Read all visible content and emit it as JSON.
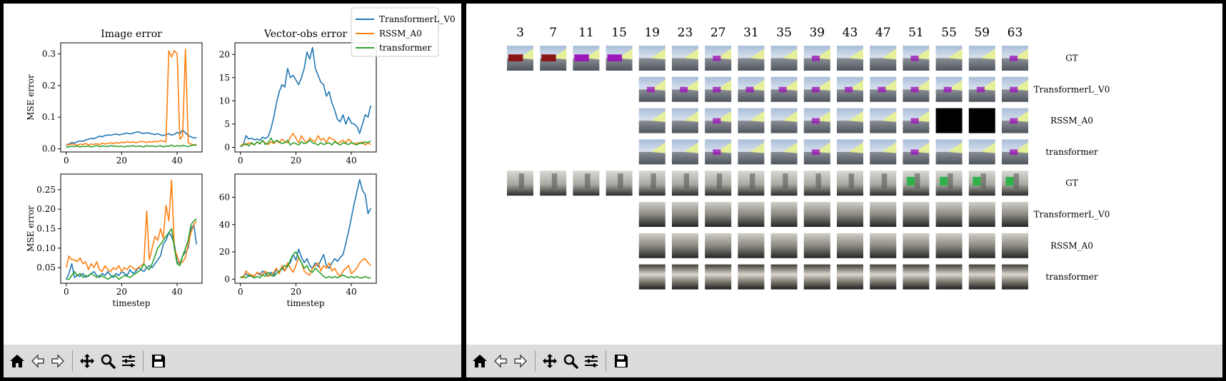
{
  "toolbar": {
    "icons": [
      "home-icon",
      "back-icon",
      "forward-icon",
      "pan-icon",
      "zoom-icon",
      "configure-icon",
      "save-icon"
    ]
  },
  "legend": {
    "entries": [
      {
        "name": "TransformerL_V0",
        "color": "#1f77b4"
      },
      {
        "name": "RSSM_A0",
        "color": "#ff7f0e"
      },
      {
        "name": "transformer",
        "color": "#2ca02c"
      }
    ]
  },
  "chart_data": [
    {
      "type": "line",
      "title": "Image error",
      "xlabel": "",
      "ylabel": "MSE error",
      "xlim": [
        -2,
        49
      ],
      "ylim": [
        -0.01,
        0.335
      ],
      "xticks": [
        0,
        20,
        40
      ],
      "yticks": [
        0.0,
        0.1,
        0.2,
        0.3
      ],
      "ytick_labels": [
        "0.0",
        "0.1",
        "0.2",
        "0.3"
      ],
      "x": [
        0,
        1,
        2,
        3,
        4,
        5,
        6,
        7,
        8,
        9,
        10,
        11,
        12,
        13,
        14,
        15,
        16,
        17,
        18,
        19,
        20,
        21,
        22,
        23,
        24,
        25,
        26,
        27,
        28,
        29,
        30,
        31,
        32,
        33,
        34,
        35,
        36,
        37,
        38,
        39,
        40,
        41,
        42,
        43,
        44,
        45,
        46,
        47
      ],
      "series": [
        {
          "name": "TransformerL_V0",
          "color": "#1f77b4",
          "values": [
            0.01,
            0.015,
            0.02,
            0.018,
            0.022,
            0.025,
            0.023,
            0.028,
            0.03,
            0.033,
            0.032,
            0.036,
            0.04,
            0.038,
            0.042,
            0.044,
            0.043,
            0.045,
            0.047,
            0.044,
            0.046,
            0.048,
            0.05,
            0.047,
            0.049,
            0.052,
            0.054,
            0.05,
            0.048,
            0.051,
            0.049,
            0.047,
            0.045,
            0.048,
            0.044,
            0.042,
            0.045,
            0.048,
            0.043,
            0.046,
            0.052,
            0.047,
            0.06,
            0.05,
            0.042,
            0.038,
            0.034,
            0.036
          ]
        },
        {
          "name": "RSSM_A0",
          "color": "#ff7f0e",
          "values": [
            0.015,
            0.012,
            0.016,
            0.014,
            0.011,
            0.015,
            0.013,
            0.017,
            0.012,
            0.015,
            0.014,
            0.016,
            0.013,
            0.018,
            0.015,
            0.017,
            0.019,
            0.016,
            0.02,
            0.018,
            0.021,
            0.019,
            0.023,
            0.02,
            0.022,
            0.019,
            0.021,
            0.024,
            0.022,
            0.02,
            0.023,
            0.021,
            0.024,
            0.022,
            0.026,
            0.024,
            0.022,
            0.31,
            0.29,
            0.31,
            0.3,
            0.03,
            0.04,
            0.315,
            0.02,
            0.015,
            0.012,
            0.014
          ]
        },
        {
          "name": "transformer",
          "color": "#2ca02c",
          "values": [
            0.005,
            0.006,
            0.008,
            0.007,
            0.009,
            0.006,
            0.008,
            0.007,
            0.009,
            0.006,
            0.008,
            0.01,
            0.007,
            0.009,
            0.008,
            0.007,
            0.01,
            0.008,
            0.009,
            0.007,
            0.008,
            0.006,
            0.009,
            0.008,
            0.01,
            0.007,
            0.009,
            0.008,
            0.006,
            0.01,
            0.008,
            0.009,
            0.007,
            0.008,
            0.01,
            0.006,
            0.009,
            0.008,
            0.012,
            0.007,
            0.01,
            0.008,
            0.011,
            0.009,
            0.007,
            0.01,
            0.012,
            0.011
          ]
        }
      ]
    },
    {
      "type": "line",
      "title": "Vector-obs error",
      "xlabel": "",
      "ylabel": "",
      "xlim": [
        -2,
        49
      ],
      "ylim": [
        -1,
        22.5
      ],
      "xticks": [
        0,
        20,
        40
      ],
      "yticks": [
        0,
        5,
        10,
        15,
        20
      ],
      "ytick_labels": [
        "0",
        "5",
        "10",
        "15",
        "20"
      ],
      "x": [
        0,
        1,
        2,
        3,
        4,
        5,
        6,
        7,
        8,
        9,
        10,
        11,
        12,
        13,
        14,
        15,
        16,
        17,
        18,
        19,
        20,
        21,
        22,
        23,
        24,
        25,
        26,
        27,
        28,
        29,
        30,
        31,
        32,
        33,
        34,
        35,
        36,
        37,
        38,
        39,
        40,
        41,
        42,
        43,
        44,
        45,
        46,
        47
      ],
      "series": [
        {
          "name": "TransformerL_V0",
          "color": "#1f77b4",
          "values": [
            0.3,
            0.5,
            2.5,
            1.8,
            2.0,
            1.6,
            1.8,
            1.5,
            2.2,
            1.9,
            2.3,
            4.0,
            6.5,
            9.5,
            12.0,
            13.5,
            13.0,
            17.0,
            15.0,
            15.5,
            14.5,
            13.5,
            15.0,
            17.0,
            20.5,
            19.0,
            21.5,
            17.0,
            15.5,
            14.0,
            13.5,
            11.0,
            12.0,
            9.5,
            8.0,
            6.0,
            5.5,
            7.0,
            5.0,
            6.5,
            5.2,
            5.0,
            4.5,
            3.0,
            5.0,
            7.0,
            6.5,
            9.0
          ]
        },
        {
          "name": "RSSM_A0",
          "color": "#ff7f0e",
          "values": [
            0.2,
            0.8,
            0.5,
            1.0,
            0.8,
            0.5,
            1.2,
            0.7,
            1.5,
            0.9,
            0.6,
            1.2,
            0.8,
            1.4,
            1.0,
            1.8,
            1.2,
            1.0,
            2.2,
            3.0,
            2.0,
            1.0,
            2.5,
            1.5,
            1.0,
            2.0,
            1.5,
            1.2,
            2.5,
            1.5,
            2.0,
            1.0,
            2.2,
            1.8,
            1.5,
            0.8,
            1.2,
            1.5,
            1.0,
            1.8,
            1.2,
            0.6,
            1.0,
            0.8,
            1.2,
            0.5,
            1.0,
            0.6
          ]
        },
        {
          "name": "transformer",
          "color": "#2ca02c",
          "values": [
            0.1,
            0.5,
            0.8,
            0.3,
            1.0,
            0.5,
            1.2,
            0.8,
            1.5,
            0.6,
            1.0,
            2.0,
            1.0,
            1.5,
            1.2,
            0.8,
            1.0,
            1.5,
            0.5,
            1.0,
            0.8,
            0.5,
            1.2,
            0.8,
            1.0,
            1.5,
            1.0,
            0.8,
            0.5,
            1.0,
            0.6,
            0.8,
            1.0,
            0.5,
            1.2,
            0.8,
            0.5,
            1.0,
            0.8,
            0.6,
            1.0,
            0.8,
            0.5,
            1.0,
            0.8,
            1.2,
            1.0,
            1.4
          ]
        }
      ]
    },
    {
      "type": "line",
      "title": "",
      "xlabel": "timestep",
      "ylabel": "MSE error",
      "xlim": [
        -2,
        49
      ],
      "ylim": [
        0.01,
        0.29
      ],
      "xticks": [
        0,
        20,
        40
      ],
      "yticks": [
        0.05,
        0.1,
        0.15,
        0.2,
        0.25
      ],
      "ytick_labels": [
        "0.05",
        "0.10",
        "0.15",
        "0.20",
        "0.25"
      ],
      "x": [
        0,
        1,
        2,
        3,
        4,
        5,
        6,
        7,
        8,
        9,
        10,
        11,
        12,
        13,
        14,
        15,
        16,
        17,
        18,
        19,
        20,
        21,
        22,
        23,
        24,
        25,
        26,
        27,
        28,
        29,
        30,
        31,
        32,
        33,
        34,
        35,
        36,
        37,
        38,
        39,
        40,
        41,
        42,
        43,
        44,
        45,
        46,
        47
      ],
      "series": [
        {
          "name": "TransformerL_V0",
          "color": "#1f77b4",
          "values": [
            0.02,
            0.035,
            0.06,
            0.025,
            0.03,
            0.028,
            0.035,
            0.025,
            0.03,
            0.035,
            0.04,
            0.03,
            0.025,
            0.035,
            0.03,
            0.04,
            0.03,
            0.025,
            0.035,
            0.03,
            0.04,
            0.035,
            0.03,
            0.045,
            0.035,
            0.04,
            0.05,
            0.045,
            0.04,
            0.05,
            0.055,
            0.05,
            0.06,
            0.07,
            0.08,
            0.11,
            0.12,
            0.14,
            0.13,
            0.11,
            0.065,
            0.06,
            0.08,
            0.09,
            0.1,
            0.15,
            0.16,
            0.11
          ]
        },
        {
          "name": "RSSM_A0",
          "color": "#ff7f0e",
          "values": [
            0.05,
            0.08,
            0.07,
            0.07,
            0.065,
            0.075,
            0.06,
            0.065,
            0.045,
            0.06,
            0.05,
            0.065,
            0.045,
            0.04,
            0.055,
            0.045,
            0.04,
            0.05,
            0.045,
            0.055,
            0.04,
            0.05,
            0.045,
            0.055,
            0.05,
            0.045,
            0.05,
            0.055,
            0.06,
            0.195,
            0.07,
            0.1,
            0.13,
            0.12,
            0.15,
            0.125,
            0.21,
            0.17,
            0.275,
            0.1,
            0.08,
            0.06,
            0.065,
            0.075,
            0.11,
            0.14,
            0.16,
            0.17
          ]
        },
        {
          "name": "transformer",
          "color": "#2ca02c",
          "values": [
            0.02,
            0.02,
            0.03,
            0.04,
            0.03,
            0.035,
            0.025,
            0.03,
            0.028,
            0.035,
            0.03,
            0.025,
            0.03,
            0.028,
            0.025,
            0.02,
            0.025,
            0.03,
            0.028,
            0.02,
            0.025,
            0.03,
            0.028,
            0.025,
            0.03,
            0.035,
            0.04,
            0.045,
            0.06,
            0.05,
            0.045,
            0.06,
            0.08,
            0.1,
            0.11,
            0.12,
            0.13,
            0.14,
            0.15,
            0.1,
            0.06,
            0.055,
            0.08,
            0.1,
            0.12,
            0.16,
            0.17,
            0.175
          ]
        }
      ]
    },
    {
      "type": "line",
      "title": "",
      "xlabel": "timestep",
      "ylabel": "",
      "xlim": [
        -2,
        49
      ],
      "ylim": [
        -3,
        77
      ],
      "xticks": [
        0,
        20,
        40
      ],
      "yticks": [
        0,
        20,
        40,
        60
      ],
      "ytick_labels": [
        "0",
        "20",
        "40",
        "60"
      ],
      "x": [
        0,
        1,
        2,
        3,
        4,
        5,
        6,
        7,
        8,
        9,
        10,
        11,
        12,
        13,
        14,
        15,
        16,
        17,
        18,
        19,
        20,
        21,
        22,
        23,
        24,
        25,
        26,
        27,
        28,
        29,
        30,
        31,
        32,
        33,
        34,
        35,
        36,
        37,
        38,
        39,
        40,
        41,
        42,
        43,
        44,
        45,
        46,
        47
      ],
      "series": [
        {
          "name": "TransformerL_V0",
          "color": "#1f77b4",
          "values": [
            1,
            2,
            4,
            2,
            3,
            2,
            5,
            3,
            6,
            4,
            2,
            5,
            3,
            7,
            5,
            8,
            6,
            10,
            12,
            18,
            14,
            22,
            16,
            12,
            15,
            10,
            8,
            12,
            9,
            14,
            18,
            10,
            8,
            12,
            15,
            13,
            16,
            18,
            26,
            35,
            45,
            55,
            64,
            73,
            65,
            62,
            48,
            52
          ]
        },
        {
          "name": "RSSM_A0",
          "color": "#ff7f0e",
          "values": [
            2,
            1,
            6,
            4,
            3,
            2,
            5,
            4,
            3,
            6,
            2,
            3,
            5,
            8,
            4,
            10,
            6,
            12,
            8,
            5,
            10,
            16,
            12,
            6,
            4,
            3,
            8,
            10,
            12,
            6,
            10,
            8,
            12,
            6,
            8,
            4,
            2,
            6,
            8,
            10,
            4,
            6,
            8,
            12,
            14,
            15,
            12,
            10
          ]
        },
        {
          "name": "transformer",
          "color": "#2ca02c",
          "values": [
            1,
            2,
            1,
            3,
            2,
            1,
            2,
            1,
            3,
            2,
            5,
            3,
            2,
            4,
            6,
            8,
            10,
            9,
            14,
            18,
            20,
            16,
            12,
            8,
            10,
            6,
            5,
            8,
            6,
            4,
            2,
            1,
            2,
            1,
            2,
            1,
            2,
            3,
            2,
            1,
            2,
            1,
            2,
            1,
            1,
            2,
            1,
            1
          ]
        }
      ]
    }
  ],
  "grid": {
    "columns": [
      "3",
      "7",
      "11",
      "15",
      "19",
      "23",
      "27",
      "31",
      "35",
      "39",
      "43",
      "47",
      "51",
      "55",
      "59",
      "63"
    ],
    "rows": [
      {
        "label": "GT",
        "env": "outdoor",
        "start": 0,
        "black": []
      },
      {
        "label": "TransformerL_V0",
        "env": "outdoor",
        "start": 4,
        "black": []
      },
      {
        "label": "RSSM_A0",
        "env": "outdoor",
        "start": 4,
        "black": [
          13,
          14
        ]
      },
      {
        "label": "transformer",
        "env": "outdoor",
        "start": 4,
        "black": []
      },
      {
        "label": "GT",
        "env": "indoor",
        "start": 0,
        "black": []
      },
      {
        "label": "TransformerL_V0",
        "env": "indoor-blur",
        "start": 4,
        "black": []
      },
      {
        "label": "RSSM_A0",
        "env": "indoor-blur",
        "start": 4,
        "black": []
      },
      {
        "label": "transformer",
        "env": "indoor-blurred",
        "start": 4,
        "black": []
      }
    ]
  }
}
